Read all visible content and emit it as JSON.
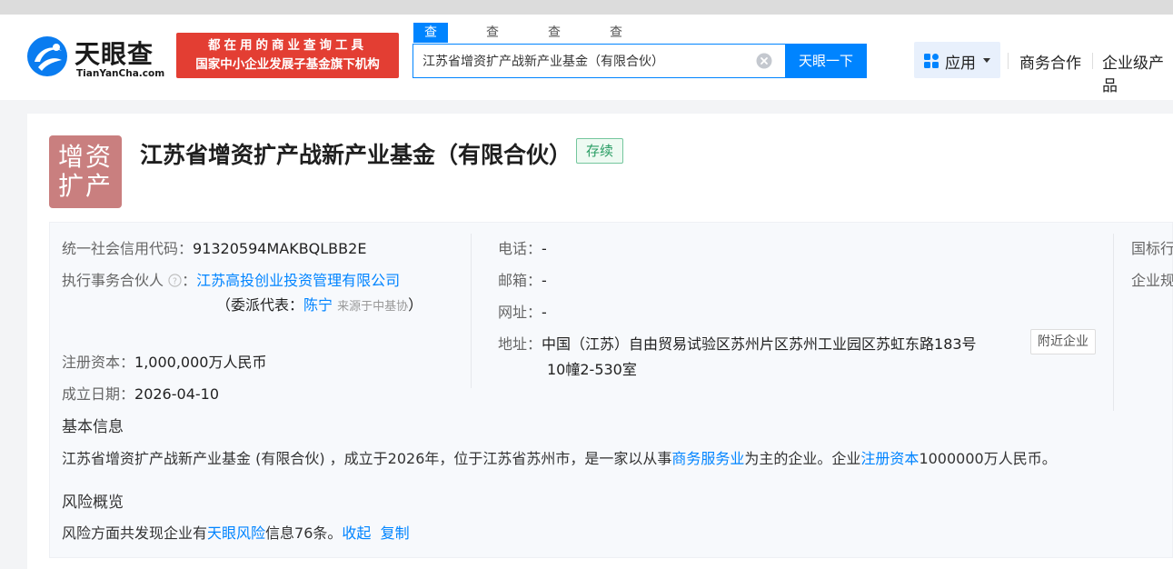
{
  "header": {
    "logo_title": "天眼查",
    "logo_sub": "TianYanCha.com",
    "slogan_line1": "都在用的商业查询工具",
    "slogan_line2": "国家中小企业发展子基金旗下机构",
    "tabs": [
      {
        "label": "查公司"
      },
      {
        "label": "查老板"
      },
      {
        "label": "查关系"
      },
      {
        "label": "查风险"
      }
    ],
    "search_value": "江苏省增资扩产战新产业基金（有限合伙）",
    "search_button": "天眼一下",
    "apps_label": "应用",
    "nav_links": [
      "商务合作",
      "企业级产品"
    ]
  },
  "company": {
    "avatar_text_line1": "增资",
    "avatar_text_line2": "扩产",
    "name": "江苏省增资扩产战新产业基金（有限合伙）",
    "status": "存续"
  },
  "info": {
    "credit_code_label": "统一社会信用代码：",
    "credit_code": "91320594MAKBQLBB2E",
    "partner_label": "执行事务合伙人",
    "partner_colon": "：",
    "partner_name": "江苏高投创业投资管理有限公司",
    "delegate_prefix": "（委派代表：",
    "delegate_name": "陈宁",
    "delegate_source": "来源于中基协",
    "delegate_suffix": "）",
    "capital_label": "注册资本：",
    "capital": "1,000,000万人民币",
    "founded_label": "成立日期：",
    "founded": "2026-04-10",
    "phone_label": "电话：",
    "phone": "-",
    "email_label": "邮箱：",
    "email": "-",
    "website_label": "网址：",
    "website": "-",
    "address_label": "地址：",
    "address_line1": "中国（江苏）自由贸易试验区苏州片区苏州工业园区苏虹东路183号",
    "address_line2": "10幢2-530室",
    "nearby_button": "附近企业",
    "right_col_label1": "国标行",
    "right_col_label2": "企业规"
  },
  "basic": {
    "heading": "基本信息",
    "text_part1": "江苏省增资扩产战新产业基金 (有限合伙) ，成立于2026年，位于江苏省苏州市，是一家以从事",
    "link1": "商务服务业",
    "text_part2": "为主的企业。企业",
    "link2": "注册资本",
    "text_part3": "1000000万人民币。"
  },
  "risk": {
    "heading": "风险概览",
    "text_part1": "风险方面共发现企业有",
    "link1": "天眼风险",
    "text_part2": "信息76条。",
    "collapse": "收起",
    "copy": "复制"
  },
  "colors": {
    "brand_blue": "#0084ff",
    "slogan_red": "#e33e33",
    "avatar_bg": "#c97f7f",
    "status_green": "#2a9d64"
  }
}
